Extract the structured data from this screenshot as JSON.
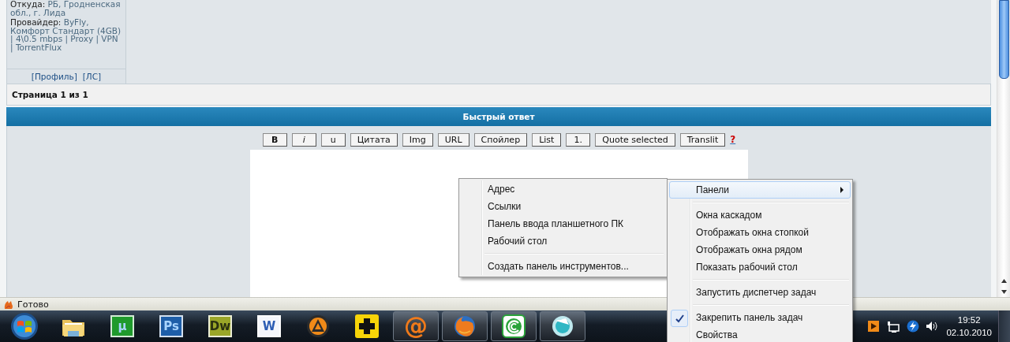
{
  "profile": {
    "fields": [
      {
        "label": "Откуда:",
        "value": "РБ, Гродненская обл., г. Лида"
      },
      {
        "label": "Провайдер:",
        "value": "ByFly, Комфорт Стандарт (4GB) | 4\\0.5 mbps | Proxy | VPN | TorrentFlux"
      }
    ],
    "links": [
      "[Профиль]",
      "[ЛС]"
    ]
  },
  "pagination": "Страница 1 из 1",
  "quick_reply": {
    "title": "Быстрый ответ",
    "buttons": [
      {
        "label": "B",
        "kind": "bold"
      },
      {
        "label": "i",
        "kind": "italic"
      },
      {
        "label": "u",
        "kind": "plain"
      },
      {
        "label": "Цитата",
        "kind": "plain"
      },
      {
        "label": "Img",
        "kind": "plain"
      },
      {
        "label": "URL",
        "kind": "plain"
      },
      {
        "label": "Спойлер",
        "kind": "plain"
      },
      {
        "label": "List",
        "kind": "plain"
      },
      {
        "label": "1.",
        "kind": "plain"
      },
      {
        "label": "Quote selected",
        "kind": "plain"
      },
      {
        "label": "Translit",
        "kind": "plain"
      }
    ],
    "help": "?"
  },
  "status_bar": {
    "text": "Готово"
  },
  "taskbar": {
    "apps": [
      {
        "kind": "folder",
        "running": false
      },
      {
        "kind": "tile",
        "label": "µ",
        "color": "#1f9a2c",
        "running": false
      },
      {
        "kind": "tile",
        "label": "Ps",
        "color": "#1e5ea8",
        "running": false
      },
      {
        "kind": "tile",
        "label": "Dw",
        "color": "#9aa628",
        "running": false
      },
      {
        "kind": "tile",
        "label": "W",
        "color": "#f4f6fb",
        "running": false
      },
      {
        "kind": "ring",
        "running": false
      },
      {
        "kind": "plus",
        "running": false
      },
      {
        "kind": "glyph",
        "label": "@",
        "color": "#f07a1a",
        "running": true
      },
      {
        "kind": "globe",
        "running": true
      },
      {
        "kind": "swirl",
        "running": true
      },
      {
        "kind": "orb",
        "running": true
      }
    ],
    "clock": {
      "time": "19:52",
      "date": "02.10.2010"
    }
  },
  "submenu": {
    "items": [
      {
        "kind": "item",
        "label": "Адрес",
        "selected": false
      },
      {
        "kind": "item",
        "label": "Ссылки",
        "selected": false
      },
      {
        "kind": "item",
        "label": "Панель ввода планшетного ПК",
        "selected": false
      },
      {
        "kind": "item",
        "label": "Рабочий стол",
        "selected": false
      },
      {
        "kind": "separator"
      },
      {
        "kind": "item",
        "label": "Создать панель инструментов...",
        "selected": false
      }
    ]
  },
  "context_menu": {
    "items": [
      {
        "kind": "submenu",
        "label": "Панели",
        "selected": true,
        "checked": false
      },
      {
        "kind": "separator"
      },
      {
        "kind": "item",
        "label": "Окна каскадом",
        "selected": false,
        "checked": false
      },
      {
        "kind": "item",
        "label": "Отображать окна стопкой",
        "selected": false,
        "checked": false
      },
      {
        "kind": "item",
        "label": "Отображать окна рядом",
        "selected": false,
        "checked": false
      },
      {
        "kind": "item",
        "label": "Показать рабочий стол",
        "selected": false,
        "checked": false
      },
      {
        "kind": "separator"
      },
      {
        "kind": "item",
        "label": "Запустить диспетчер задач",
        "selected": false,
        "checked": false
      },
      {
        "kind": "separator"
      },
      {
        "kind": "item",
        "label": "Закрепить панель задач",
        "selected": false,
        "checked": true
      },
      {
        "kind": "item",
        "label": "Свойства",
        "selected": false,
        "checked": false
      }
    ]
  }
}
